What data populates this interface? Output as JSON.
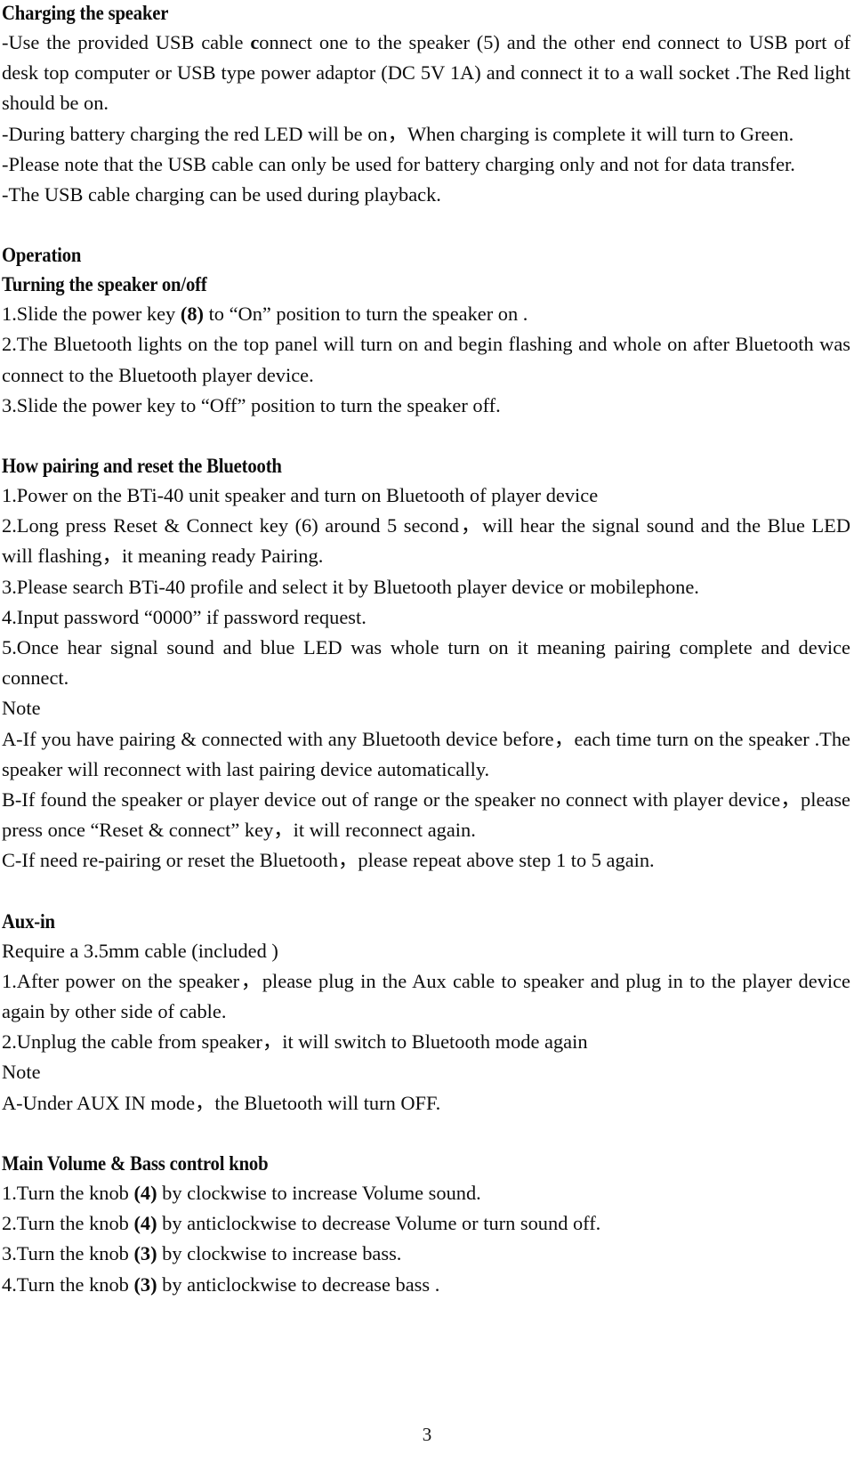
{
  "document": {
    "page_number": "3",
    "sections": [
      {
        "id": "charging",
        "heading": "Charging the speaker",
        "paragraphs": [
          {
            "id": "charging-p1",
            "runs": [
              {
                "text": "-Use the provided USB cable ",
                "bold": false
              },
              {
                "text": "c",
                "bold": true
              },
              {
                "text": "onnect one to the speaker (5) and the other end connect to USB port of desk top computer or USB type power adaptor (DC 5V 1A) and connect it to a wall socket .The Red light should be on.",
                "bold": false
              }
            ]
          },
          {
            "id": "charging-p2",
            "runs": [
              {
                "text": "-During battery charging the red LED will be on，When charging is complete it will turn to Green.",
                "bold": false
              }
            ]
          },
          {
            "id": "charging-p3",
            "runs": [
              {
                "text": "-Please note that the USB cable can only be used for battery charging only and not for data transfer.",
                "bold": false
              }
            ]
          },
          {
            "id": "charging-p4",
            "runs": [
              {
                "text": "-The USB cable charging can be used during playback.",
                "bold": false
              }
            ]
          }
        ]
      },
      {
        "id": "operation",
        "heading": "Operation",
        "subheading": "Turning the speaker on/off",
        "paragraphs": [
          {
            "id": "operation-1",
            "runs": [
              {
                "text": "1.Slide the power key ",
                "bold": false
              },
              {
                "text": "(8)",
                "bold": true
              },
              {
                "text": " to “On” position to turn the speaker on   .",
                "bold": false
              }
            ]
          },
          {
            "id": "operation-2",
            "runs": [
              {
                "text": "2.The Bluetooth lights on the top panel will turn on and begin flashing and whole on after Bluetooth was connect to the Bluetooth player device.",
                "bold": false
              }
            ]
          },
          {
            "id": "operation-3",
            "runs": [
              {
                "text": "3.Slide the power key to “Off” position to turn the speaker off.",
                "bold": false
              }
            ]
          }
        ]
      },
      {
        "id": "pairing",
        "heading": "How pairing and reset the Bluetooth",
        "paragraphs": [
          {
            "id": "pairing-1",
            "runs": [
              {
                "text": "1.Power on the BTi-40 unit speaker and turn on Bluetooth of player device",
                "bold": false
              }
            ]
          },
          {
            "id": "pairing-2",
            "runs": [
              {
                "text": "2.Long press Reset & Connect key (6) around 5 second，will hear the signal sound and the Blue LED will flashing，it meaning ready Pairing.",
                "bold": false
              }
            ]
          },
          {
            "id": "pairing-3",
            "runs": [
              {
                "text": "3.Please search BTi-40 profile and select it by Bluetooth player device or mobilephone.",
                "bold": false
              }
            ]
          },
          {
            "id": "pairing-4",
            "runs": [
              {
                "text": "4.Input password “0000” if password request.",
                "bold": false
              }
            ]
          },
          {
            "id": "pairing-5",
            "runs": [
              {
                "text": "5.Once hear signal sound and blue LED was whole turn on it meaning pairing complete and device connect.",
                "bold": false
              }
            ]
          },
          {
            "id": "pairing-note-label",
            "runs": [
              {
                "text": "Note",
                "bold": false
              }
            ]
          },
          {
            "id": "pairing-note-a",
            "runs": [
              {
                "text": "A-If you have pairing & connected with any Bluetooth device before，each time turn on the speaker .The speaker will reconnect with last pairing device automatically.",
                "bold": false
              }
            ]
          },
          {
            "id": "pairing-note-b",
            "runs": [
              {
                "text": "B-If found the speaker or player device out of range or the speaker no connect with player device，please press once “Reset & connect” key，it will reconnect again.",
                "bold": false
              }
            ]
          },
          {
            "id": "pairing-note-c",
            "runs": [
              {
                "text": "C-If need re-pairing or reset the Bluetooth，please repeat above step 1 to 5 again.",
                "bold": false
              }
            ]
          }
        ]
      },
      {
        "id": "aux-in",
        "heading": "Aux-in",
        "paragraphs": [
          {
            "id": "aux-require",
            "runs": [
              {
                "text": "Require a 3.5mm cable (included )",
                "bold": false
              }
            ]
          },
          {
            "id": "aux-1",
            "runs": [
              {
                "text": "1.After power on the speaker，please plug in the Aux cable to speaker and plug in to the player device again by other side of cable.",
                "bold": false
              }
            ]
          },
          {
            "id": "aux-2",
            "runs": [
              {
                "text": "2.Unplug the cable from speaker，it will switch to Bluetooth mode again",
                "bold": false
              }
            ]
          },
          {
            "id": "aux-note-label",
            "runs": [
              {
                "text": "Note",
                "bold": false
              }
            ]
          },
          {
            "id": "aux-note-a",
            "runs": [
              {
                "text": "A-Under AUX IN mode，the Bluetooth will turn OFF.",
                "bold": false
              }
            ]
          }
        ]
      },
      {
        "id": "volume-bass",
        "heading": "Main Volume & Bass control knob",
        "paragraphs": [
          {
            "id": "knob-1",
            "runs": [
              {
                "text": "1.Turn the knob ",
                "bold": false
              },
              {
                "text": "(4)",
                "bold": true
              },
              {
                "text": " by clockwise to increase Volume sound.",
                "bold": false
              }
            ]
          },
          {
            "id": "knob-2",
            "runs": [
              {
                "text": "2.Turn the knob ",
                "bold": false
              },
              {
                "text": "(4)",
                "bold": true
              },
              {
                "text": " by anticlockwise to decrease Volume or turn sound off.",
                "bold": false
              }
            ]
          },
          {
            "id": "knob-3",
            "runs": [
              {
                "text": "3.Turn the knob ",
                "bold": false
              },
              {
                "text": "(3)",
                "bold": true
              },
              {
                "text": " by clockwise to increase bass.",
                "bold": false
              }
            ]
          },
          {
            "id": "knob-4",
            "runs": [
              {
                "text": "4.Turn the knob ",
                "bold": false
              },
              {
                "text": "(3)",
                "bold": true
              },
              {
                "text": " by anticlockwise to decrease bass .",
                "bold": false
              }
            ]
          }
        ]
      }
    ]
  }
}
